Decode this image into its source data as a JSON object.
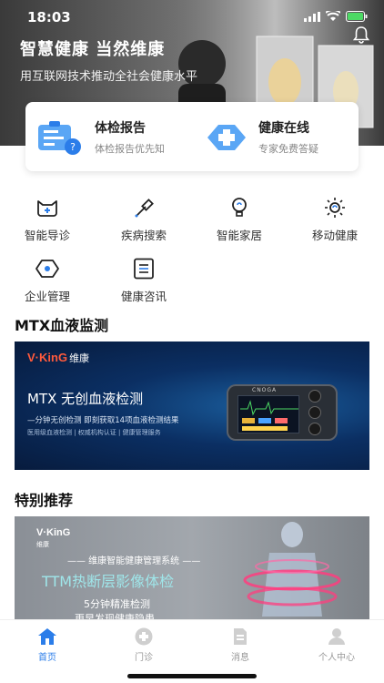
{
  "status": {
    "time": "18:03"
  },
  "hero": {
    "title": "智慧健康 当然维康",
    "subtitle": "用互联网技术推动全社会健康水平"
  },
  "services": [
    {
      "title": "体检报告",
      "subtitle": "体检报告优先知",
      "icon": "report-icon"
    },
    {
      "title": "健康在线",
      "subtitle": "专家免费答疑",
      "icon": "medical-cross-icon"
    }
  ],
  "grid": [
    {
      "label": "智能导诊",
      "icon": "triage-icon"
    },
    {
      "label": "疾病搜索",
      "icon": "dropper-icon"
    },
    {
      "label": "智能家居",
      "icon": "bulb-icon"
    },
    {
      "label": "移动健康",
      "icon": "sun-icon"
    },
    {
      "label": "企业管理",
      "icon": "hexagon-icon"
    },
    {
      "label": "健康咨讯",
      "icon": "document-icon"
    }
  ],
  "sections": {
    "blood": "MTX血液监测",
    "recommend": "特别推荐"
  },
  "banner1": {
    "logo": "V·KinG",
    "logo_cn": "维康",
    "title": "MTX 无创血液检测",
    "subtitle": "—分钟无创检测  即刻获取14项血液检测结果",
    "features": "医用级血液检测 | 权威机构认证 | 健康管理服务",
    "device_brand": "CNOGA"
  },
  "banner2": {
    "logo": "V·KinG",
    "logo_cn": "维康",
    "system": "—— 维康智能健康管理系统 ——",
    "title": "TTM热断层影像体检",
    "subtitle": "5分钟精准检测",
    "subtitle2": "更早发现健康隐患"
  },
  "tabs": [
    {
      "label": "首页",
      "active": true
    },
    {
      "label": "门诊"
    },
    {
      "label": "消息"
    },
    {
      "label": "个人中心"
    }
  ],
  "colors": {
    "accent": "#2b7de9",
    "hero_bg": "#555555"
  }
}
